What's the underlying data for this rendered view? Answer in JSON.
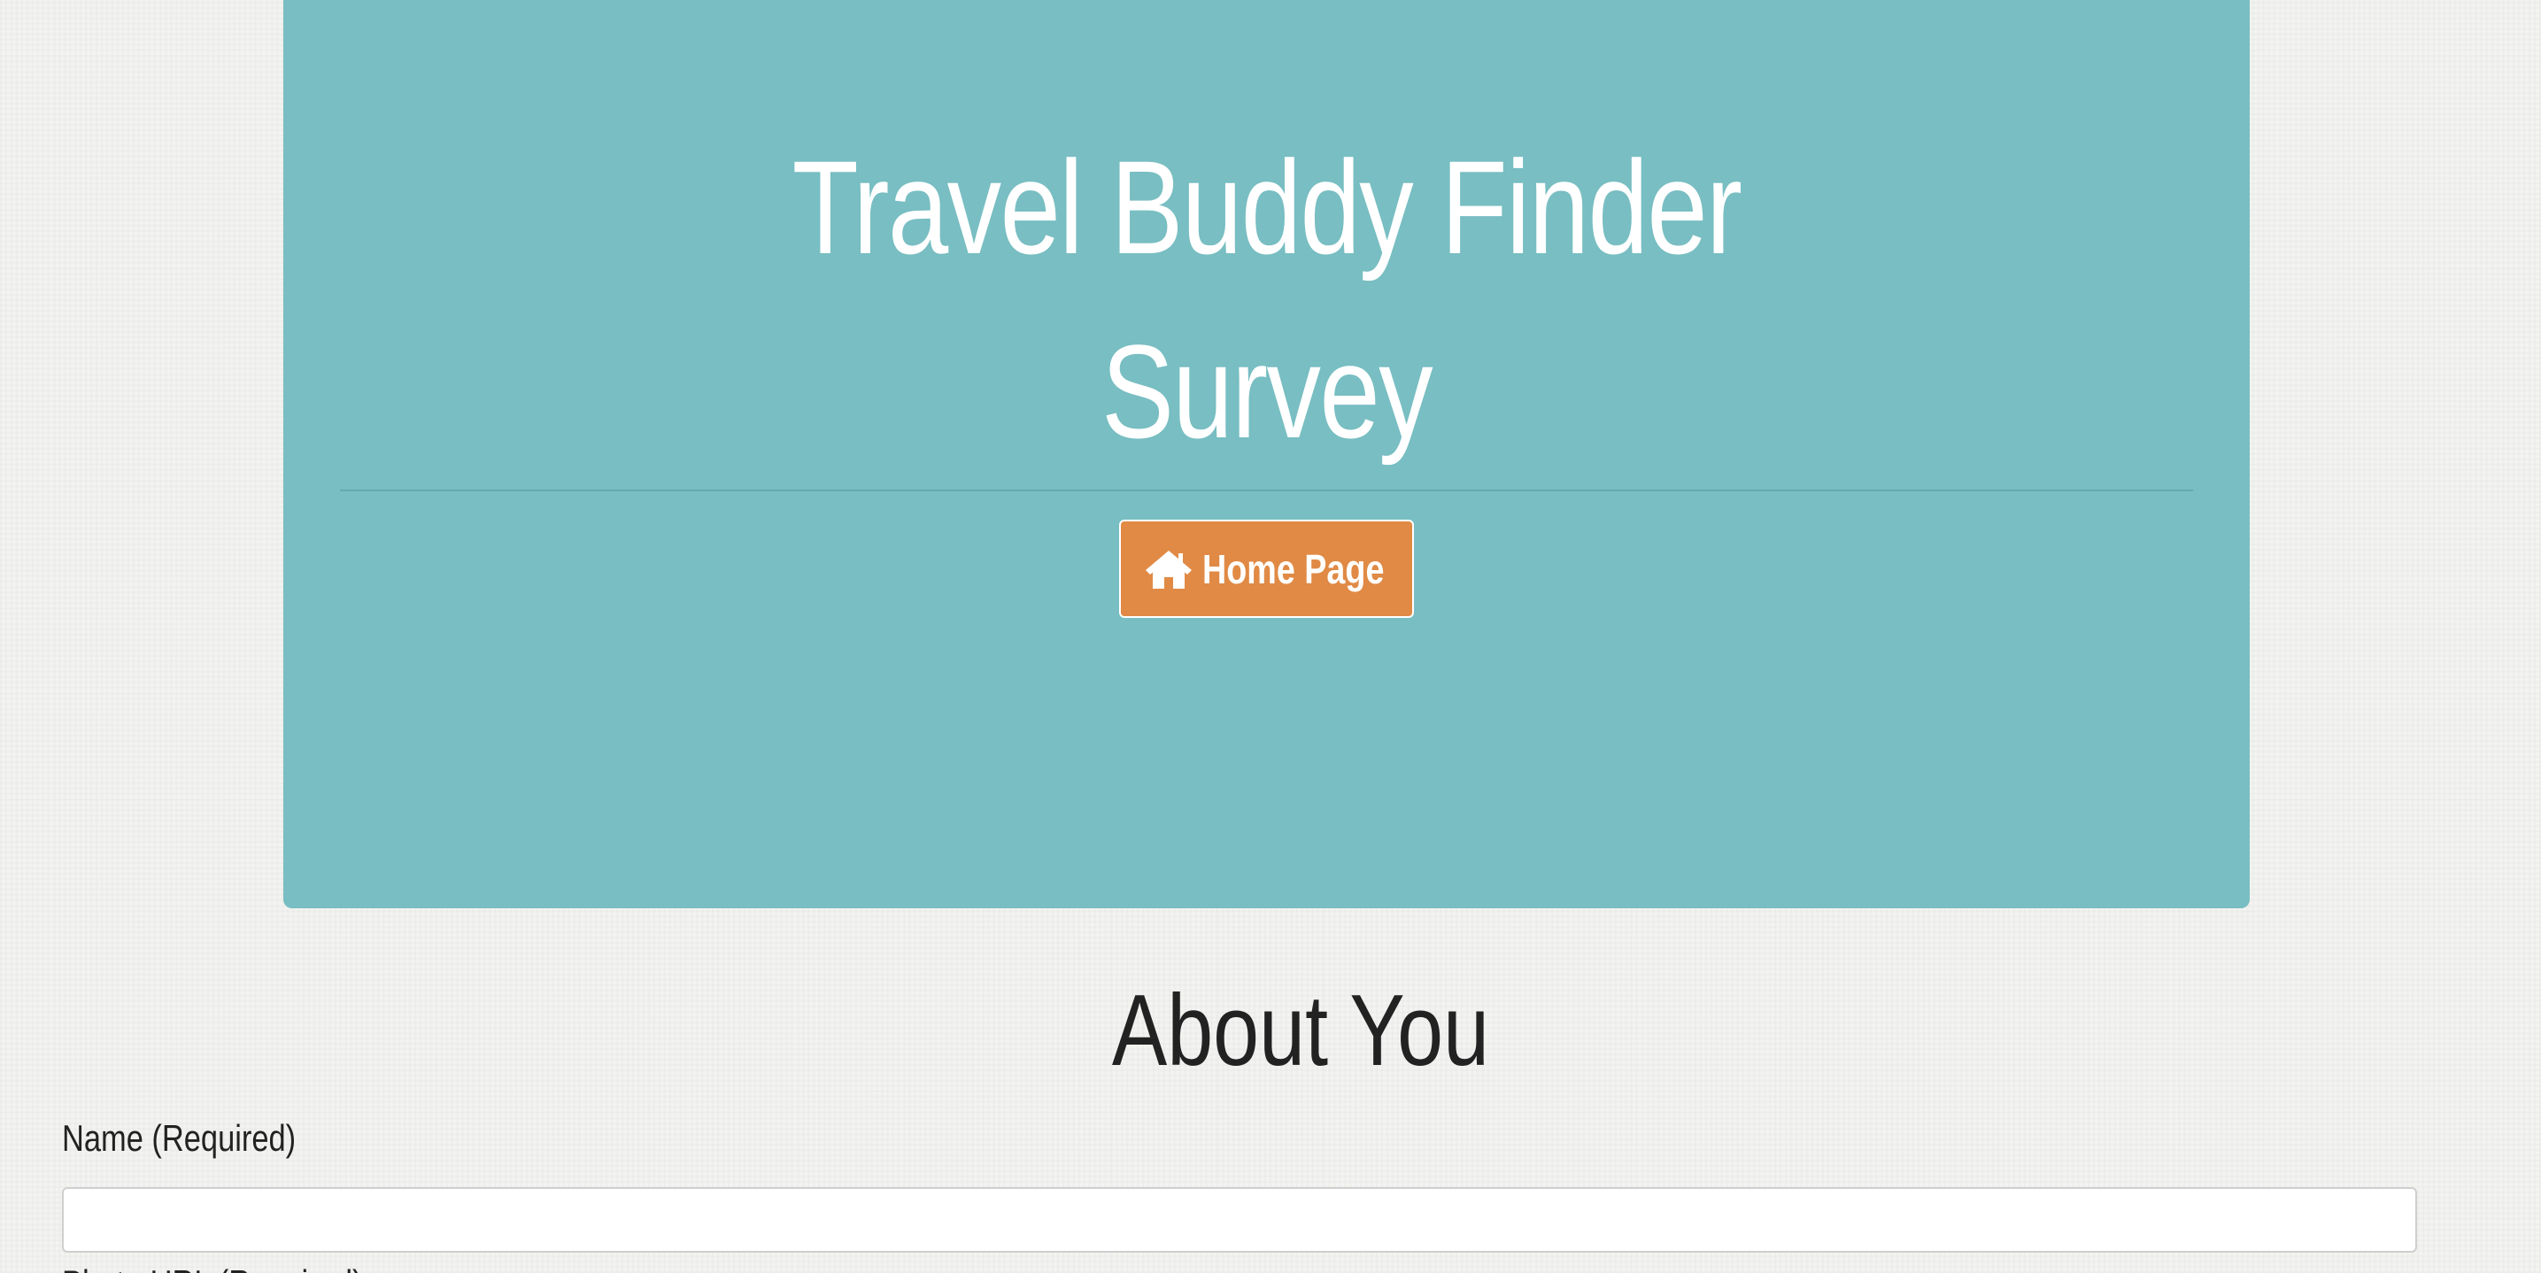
{
  "header": {
    "title_line1": "Travel Buddy Finder",
    "title_line2": "Survey",
    "home_button": {
      "label": "Home Page",
      "icon": "home-icon"
    }
  },
  "section": {
    "title": "About You"
  },
  "form": {
    "name_label": "Name (Required)",
    "name_value": "",
    "photo_label": "Photo URL (Required)"
  },
  "colors": {
    "jumbotron": "#78bec2",
    "button": "#e08a45",
    "text_white": "#ffffff",
    "text_dark": "#222222"
  }
}
